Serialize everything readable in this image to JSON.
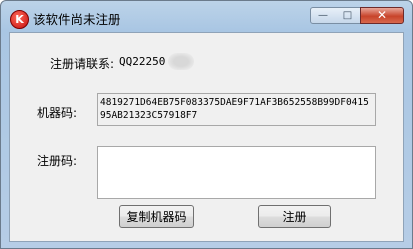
{
  "window": {
    "title": "该软件尚未注册",
    "icon_letter": "K",
    "icon": "app-logo-icon",
    "controls": {
      "minimize": "minimize-icon",
      "maximize": "maximize-icon",
      "close": "close-icon"
    },
    "colors": {
      "frame": "#b6cde6",
      "client": "#f0f0f0",
      "close_button": "#c8442b",
      "icon_red": "#c50d0d"
    }
  },
  "contact": {
    "label": "注册请联系:",
    "value": "QQ22250"
  },
  "machine_code": {
    "label": "机器码:",
    "value": "4819271D64EB75F083375DAE9F71AF3B652558B99DF041595AB21323C57918F7"
  },
  "registration_code": {
    "label": "注册码:",
    "value": ""
  },
  "buttons": {
    "copy_machine_code": "复制机器码",
    "register": "注册"
  }
}
